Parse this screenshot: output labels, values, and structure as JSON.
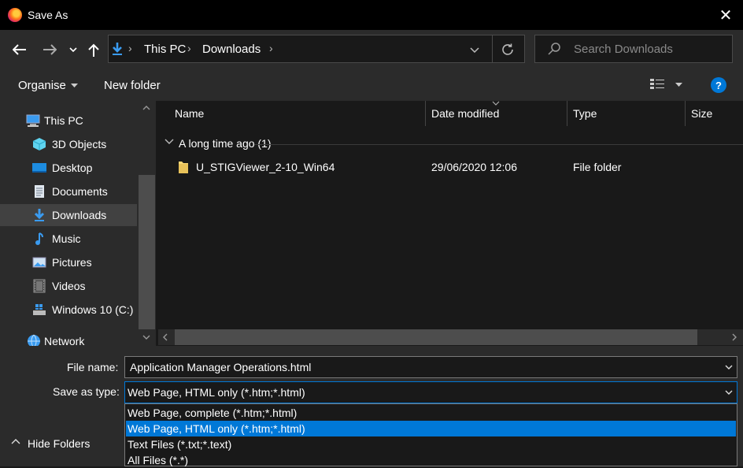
{
  "window": {
    "title": "Save As",
    "close_glyph": "✕"
  },
  "nav": {
    "back_icon": "arrow-left-icon",
    "forward_icon": "arrow-right-icon",
    "recent_icon": "chevron-down-icon",
    "up_icon": "arrow-up-icon",
    "breadcrumb": [
      "This PC",
      "Downloads"
    ],
    "separator": "›",
    "search_placeholder": "Search Downloads"
  },
  "toolbar": {
    "organise_label": "Organise",
    "new_folder_label": "New folder",
    "help_label": "?"
  },
  "sidebar": {
    "items": [
      {
        "label": "This PC",
        "icon": "computer-icon"
      },
      {
        "label": "3D Objects",
        "icon": "cube-icon"
      },
      {
        "label": "Desktop",
        "icon": "desktop-icon"
      },
      {
        "label": "Documents",
        "icon": "document-icon"
      },
      {
        "label": "Downloads",
        "icon": "download-icon",
        "selected": true
      },
      {
        "label": "Music",
        "icon": "music-note-icon"
      },
      {
        "label": "Pictures",
        "icon": "picture-icon"
      },
      {
        "label": "Videos",
        "icon": "film-icon"
      },
      {
        "label": "Windows 10 (C:)",
        "icon": "drive-icon"
      },
      {
        "label": "Network",
        "icon": "network-icon"
      }
    ]
  },
  "files": {
    "columns": [
      "Name",
      "Date modified",
      "Type",
      "Size"
    ],
    "group_label": "A long time ago (1)",
    "rows": [
      {
        "name": "U_STIGViewer_2-10_Win64",
        "date": "29/06/2020 12:06",
        "type": "File folder",
        "size": ""
      }
    ]
  },
  "form": {
    "filename_label": "File name:",
    "filename_value": "Application Manager Operations.html",
    "type_label": "Save as type:",
    "type_value": "Web Page, HTML only (*.htm;*.html)",
    "type_options": [
      "Web Page, complete (*.htm;*.html)",
      "Web Page, HTML only (*.htm;*.html)",
      "Text Files (*.txt;*.text)",
      "All Files (*.*)"
    ],
    "selected_option_index": 1,
    "hide_folders_label": "Hide Folders"
  },
  "colors": {
    "accent": "#0078d7",
    "folder": "#f8d775",
    "selection": "#414141"
  }
}
